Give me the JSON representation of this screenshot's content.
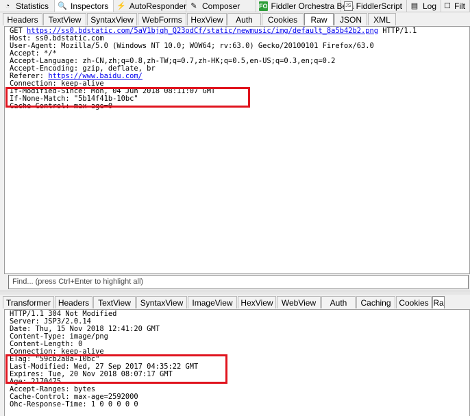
{
  "main_tabs": [
    {
      "label": "Statistics",
      "icon": "statistics-icon",
      "glyph": "◔"
    },
    {
      "label": "Inspectors",
      "icon": "inspectors-icon",
      "glyph": "🔍"
    },
    {
      "label": "AutoResponder",
      "icon": "lightning-icon",
      "glyph": "⚡"
    },
    {
      "label": "Composer",
      "icon": "composer-icon",
      "glyph": "✎"
    },
    {
      "label": "Fiddler Orchestra Beta",
      "icon": "fo-icon",
      "glyph": "FO"
    },
    {
      "label": "FiddlerScript",
      "icon": "js-icon",
      "glyph": "JS"
    },
    {
      "label": "Log",
      "icon": "log-icon",
      "glyph": "▤"
    },
    {
      "label": "Filt",
      "icon": "filter-checkbox-icon",
      "glyph": "☐"
    }
  ],
  "request": {
    "tabs": [
      "Headers",
      "TextView",
      "SyntaxView",
      "WebForms",
      "HexView",
      "Auth",
      "Cookies",
      "Raw",
      "JSON",
      "XML"
    ],
    "active_tab": "Raw",
    "lines": [
      {
        "pre": "GET ",
        "link": "https://ss0.bdstatic.com/5aV1bjqh_Q23odCf/static/newmusic/img/default_8a5b42b2.png",
        "post": " HTTP/1.1"
      },
      {
        "pre": "Host: ss0.bdstatic.com",
        "link": "",
        "post": ""
      },
      {
        "pre": "User-Agent: Mozilla/5.0 (Windows NT 10.0; WOW64; rv:63.0) Gecko/20100101 Firefox/63.0",
        "link": "",
        "post": ""
      },
      {
        "pre": "Accept: */*",
        "link": "",
        "post": ""
      },
      {
        "pre": "Accept-Language: zh-CN,zh;q=0.8,zh-TW;q=0.7,zh-HK;q=0.5,en-US;q=0.3,en;q=0.2",
        "link": "",
        "post": ""
      },
      {
        "pre": "Accept-Encoding: gzip, deflate, br",
        "link": "",
        "post": ""
      },
      {
        "pre": "Referer: ",
        "link": "https://www.baidu.com/",
        "post": ""
      },
      {
        "pre": "Connection: keep-alive",
        "link": "",
        "post": ""
      },
      {
        "pre": "If-Modified-Since: Mon, 04 Jun 2018 08:11:07 GMT",
        "link": "",
        "post": ""
      },
      {
        "pre": "If-None-Match: \"5b14f41b-10bc\"",
        "link": "",
        "post": ""
      },
      {
        "pre": "Cache-Control: max-age=0",
        "link": "",
        "post": ""
      }
    ],
    "find_placeholder": "Find... (press Ctrl+Enter to highlight all)"
  },
  "response": {
    "tabs": [
      "Transformer",
      "Headers",
      "TextView",
      "SyntaxView",
      "ImageView",
      "HexView",
      "WebView",
      "Auth",
      "Caching",
      "Cookies",
      "Ra"
    ],
    "active_tab": "Ra",
    "lines": [
      "HTTP/1.1 304 Not Modified",
      "Server: JSP3/2.0.14",
      "Date: Thu, 15 Nov 2018 12:41:20 GMT",
      "Content-Type: image/png",
      "Content-Length: 0",
      "Connection: keep-alive",
      "ETag: \"59cb2a8a-10bc\"",
      "Last-Modified: Wed, 27 Sep 2017 04:35:22 GMT",
      "Expires: Tue, 20 Nov 2018 08:07:17 GMT",
      "Age: 2170475",
      "Accept-Ranges: bytes",
      "Cache-Control: max-age=2592000",
      "Ohc-Response-Time: 1 0 0 0 0 0"
    ]
  },
  "colors": {
    "highlight_box": "#e0141e",
    "link": "#0000ee"
  }
}
